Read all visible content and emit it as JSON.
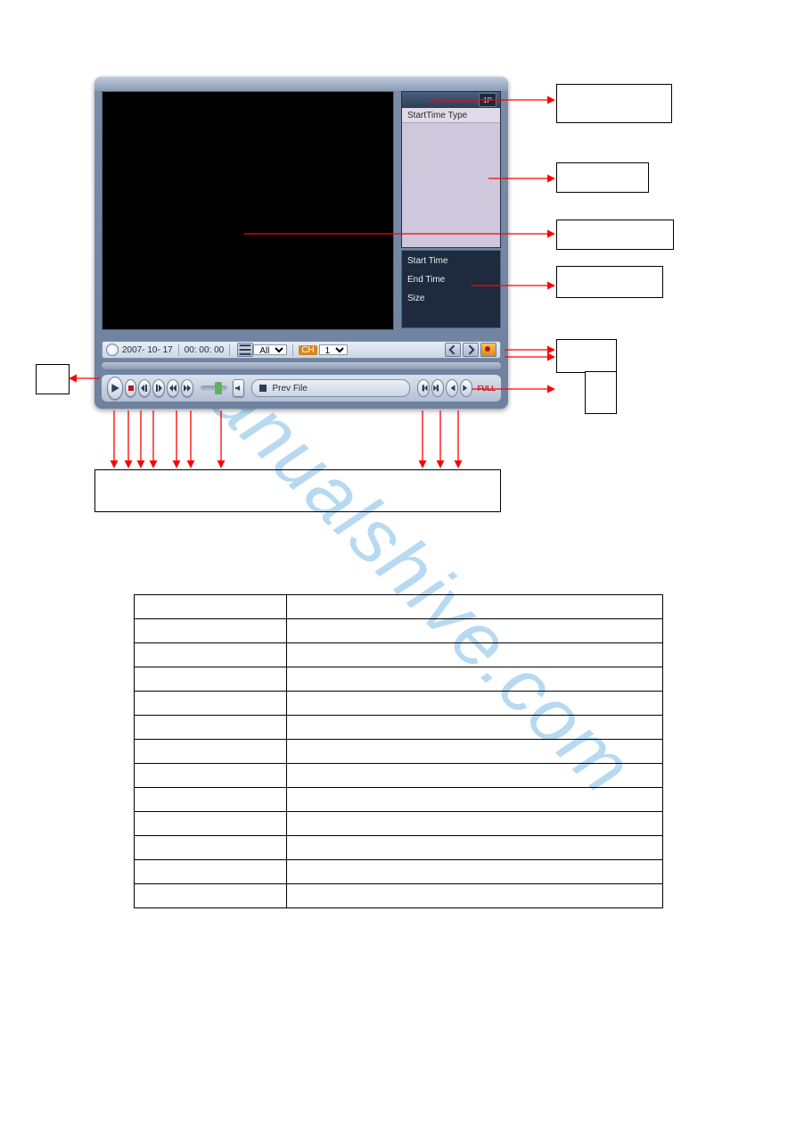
{
  "watermark": "manualshive.com",
  "player": {
    "side": {
      "toolbar_btn": "1P",
      "header": "StartTime Type",
      "info": {
        "start_label": "Start Time",
        "end_label": "End Time",
        "size_label": "Size"
      }
    },
    "infobar": {
      "date": "2007- 10- 17",
      "time": "00: 00: 00",
      "type_sel": "All",
      "ch_prefix": "CH",
      "ch_sel": "1"
    },
    "display": "Prev File",
    "full_label": "FULL"
  },
  "annotations": {
    "box1": "",
    "box2": "",
    "box3": "",
    "box4": "",
    "box5a": "",
    "box5b": "",
    "left_small": ""
  },
  "table": {
    "rows": [
      [
        "",
        ""
      ],
      [
        "",
        ""
      ],
      [
        "",
        ""
      ],
      [
        "",
        ""
      ],
      [
        "",
        ""
      ],
      [
        "",
        ""
      ],
      [
        "",
        ""
      ],
      [
        "",
        ""
      ],
      [
        "",
        ""
      ],
      [
        "",
        ""
      ],
      [
        "",
        ""
      ],
      [
        "",
        ""
      ],
      [
        "",
        ""
      ]
    ]
  }
}
